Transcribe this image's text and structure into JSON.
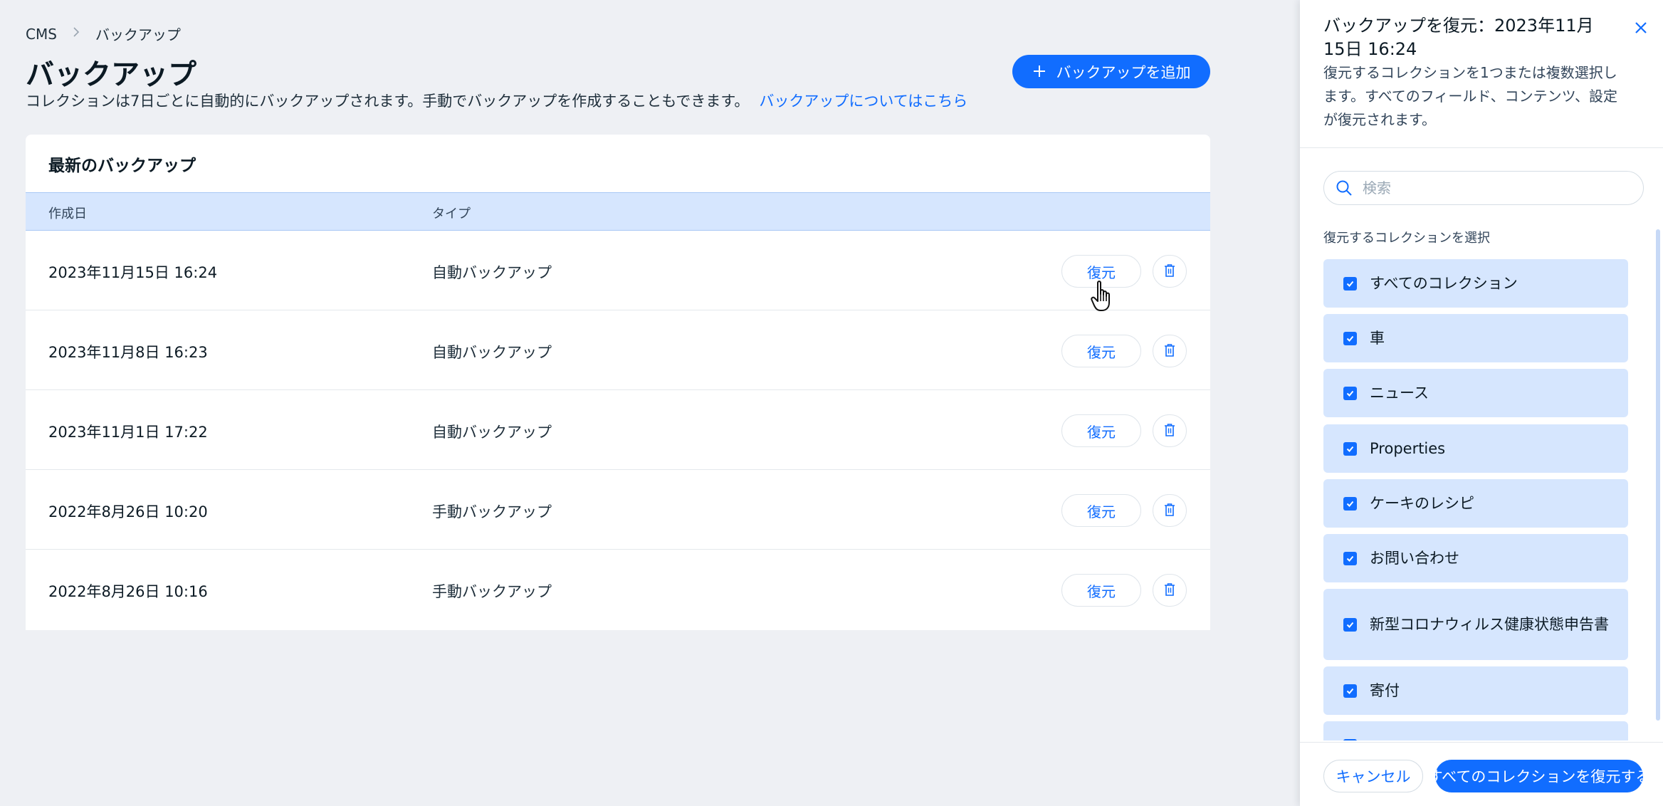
{
  "breadcrumb": {
    "root": "CMS",
    "current": "バックアップ"
  },
  "page": {
    "title": "バックアップ",
    "subtitle": "コレクションは7日ごとに自動的にバックアップされます。手動でバックアップを作成することもできます。",
    "learn_more_link": "バックアップについてはこちら",
    "add_button": "バックアップを追加"
  },
  "table": {
    "title": "最新のバックアップ",
    "columns": {
      "created": "作成日",
      "type": "タイプ"
    },
    "restore_label": "復元",
    "rows": [
      {
        "date": "2023年11月15日 16:24",
        "type": "自動バックアップ"
      },
      {
        "date": "2023年11月8日 16:23",
        "type": "自動バックアップ"
      },
      {
        "date": "2023年11月1日 17:22",
        "type": "自動バックアップ"
      },
      {
        "date": "2022年8月26日 10:20",
        "type": "手動バックアップ"
      },
      {
        "date": "2022年8月26日 10:16",
        "type": "手動バックアップ"
      }
    ]
  },
  "panel": {
    "title": "バックアップを復元：2023年11月15日 16:24",
    "description": "復元するコレクションを1つまたは複数選択します。すべてのフィールド、コンテンツ、設定が復元されます。",
    "search_placeholder": "検索",
    "select_label": "復元するコレクションを選択",
    "collections": [
      {
        "label": "すべてのコレクション",
        "checked": true
      },
      {
        "label": "車",
        "checked": true
      },
      {
        "label": "ニュース",
        "checked": true
      },
      {
        "label": "Properties",
        "checked": true
      },
      {
        "label": "ケーキのレシピ",
        "checked": true
      },
      {
        "label": "お問い合わせ",
        "checked": true
      },
      {
        "label": "新型コロナウィルス健康状態申告書",
        "checked": true
      },
      {
        "label": "寄付",
        "checked": true
      },
      {
        "label": "",
        "checked": true
      }
    ],
    "cancel_button": "キャンセル",
    "restore_all_button": "すべてのコレクションを復元する"
  },
  "colors": {
    "accent": "#116dff",
    "selected_bg": "#d6e6fe",
    "page_bg": "#eef0f4"
  }
}
